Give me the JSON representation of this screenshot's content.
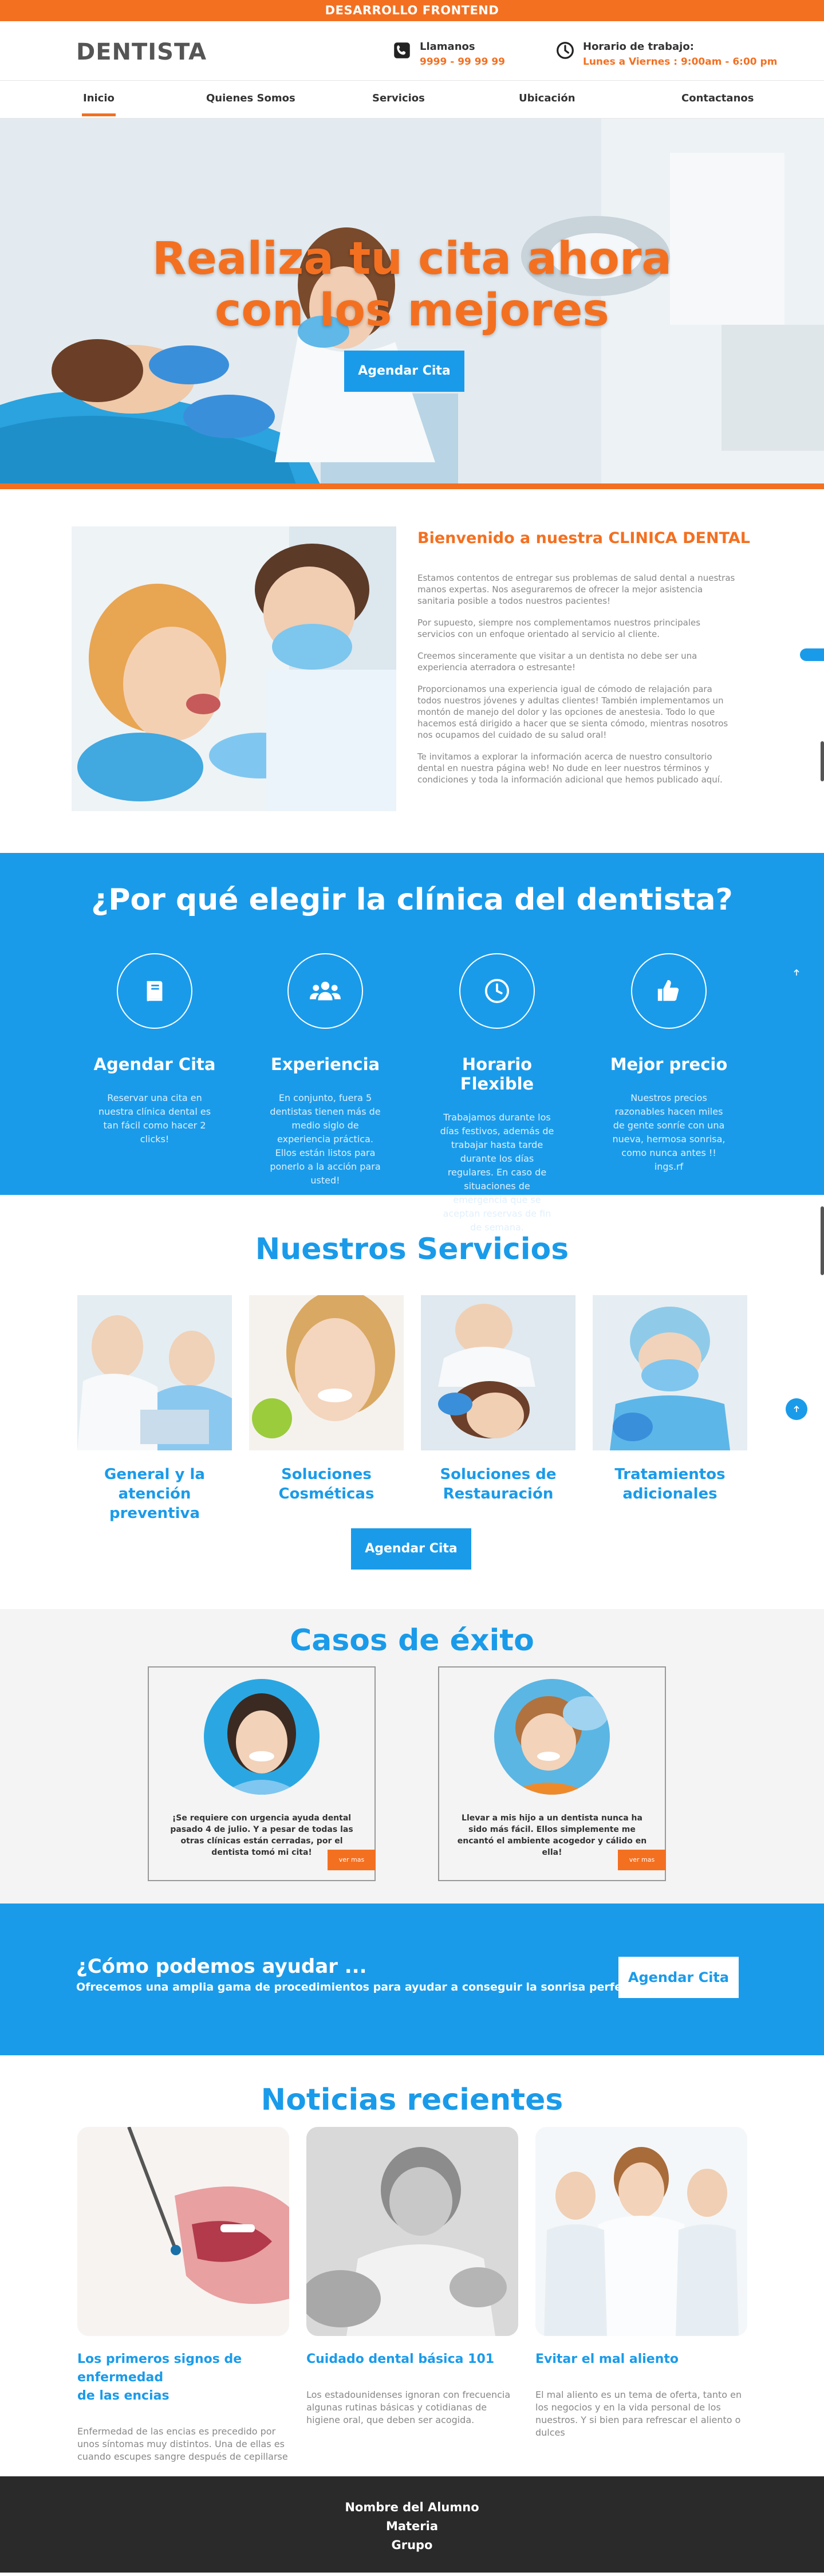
{
  "topbar": {
    "text": "DESARROLLO FRONTEND"
  },
  "header": {
    "logo": "DENTISTA",
    "phone_label": "Llamanos",
    "phone_value": "9999 - 99 99 99",
    "hours_label": "Horario de trabajo:",
    "hours_value": "Lunes a Viernes : 9:00am  - 6:00 pm"
  },
  "nav": {
    "items": [
      "Inicio",
      "Quienes Somos",
      "Servicios",
      "Ubicación",
      "Contactanos"
    ],
    "active": "Inicio"
  },
  "hero": {
    "title_line1": "Realiza tu cita ahora",
    "title_line2": "con los mejores",
    "button": "Agendar Cita"
  },
  "welcome": {
    "title": "Bienvenido a nuestra CLINICA DENTAL",
    "paragraphs": [
      "Estamos contentos de entregar sus problemas de salud dental a nuestras manos expertas. Nos aseguraremos de ofrecer la mejor asistencia sanitaria posible a todos nuestros pacientes!",
      "Por supuesto, siempre nos complementamos nuestros principales servicios con un enfoque orientado al servicio al cliente.",
      "Creemos sinceramente que visitar a un dentista no debe ser una experiencia aterradora o estresante!",
      "Proporcionamos una experiencia igual de cómodo de relajación para todos nuestros jóvenes y adultas clientes! También implementamos un montón de manejo del dolor y las opciones de anestesia. Todo lo que hacemos está dirigido a hacer que se sienta cómodo, mientras nosotros nos ocupamos del cuidado de su salud oral!",
      "Te invitamos a explorar la información acerca de nuestro consultorio dental en nuestra página web! No dude en leer nuestros términos y condiciones y toda la información adicional que hemos publicado aquí."
    ]
  },
  "why": {
    "title": "¿Por qué elegir la clínica del dentista?",
    "features": [
      {
        "icon": "book-icon",
        "title": "Agendar Cita",
        "text": "Reservar una cita en nuestra clínica dental es tan fácil como hacer 2 clicks!"
      },
      {
        "icon": "users-icon",
        "title": "Experiencia",
        "text": "En conjunto, fuera 5 dentistas tienen más de medio siglo de experiencia práctica. Ellos están listos para ponerlo a la acción para usted!"
      },
      {
        "icon": "clock-icon",
        "title": "Horario Flexible",
        "text": "Trabajamos durante los días festivos, además de trabajar hasta tarde durante los días regulares. En caso de situaciones de emergencia que se aceptan reservas de fin de semana."
      },
      {
        "icon": "thumbs-up-icon",
        "title": "Mejor precio",
        "text": "Nuestros precios razonables hacen miles de gente sonríe con una nueva, hermosa sonrisa, como nunca antes !! ings.rf"
      }
    ]
  },
  "services": {
    "title": "Nuestros Servicios",
    "items": [
      {
        "line1": "General y la atención",
        "line2": "preventiva"
      },
      {
        "line1": "Soluciones",
        "line2": "Cosméticas"
      },
      {
        "line1": "Soluciones de",
        "line2": "Restauración"
      },
      {
        "line1": "Tratamientos",
        "line2": "adicionales"
      }
    ],
    "button": "Agendar Cita"
  },
  "cases": {
    "title": "Casos de éxito",
    "items": [
      {
        "text": "¡Se requiere con urgencia ayuda dental pasado 4 de julio. Y a pesar de todas las otras clínicas están cerradas, por el dentista tomó mi cita!",
        "more": "ver mas"
      },
      {
        "text": "Llevar a mis hijo a un dentista nunca ha sido más fácil. Ellos simplemente me encantó el ambiente acogedor y cálido en ella!",
        "more": "ver mas"
      }
    ]
  },
  "help": {
    "title": "¿Cómo podemos ayudar ...",
    "text": "Ofrecemos una amplia gama de procedimientos para ayudar a conseguir la sonrisa perfecta.",
    "button": "Agendar Cita"
  },
  "news": {
    "title": "Noticias recientes",
    "posts": [
      {
        "title_line1": "Los primeros signos de enfermedad",
        "title_line2": "de las encias",
        "text": "Enfermedad de las encias es precedido por unos síntomas muy distintos. Una de ellas es cuando escupes sangre después de cepillarse"
      },
      {
        "title_line1": "Cuidado dental básica 101",
        "title_line2": "",
        "text": "Los estadounidenses ignoran con frecuencia algunas rutinas básicas y cotidianas de higiene oral, que deben ser acogida."
      },
      {
        "title_line1": "Evitar el mal aliento",
        "title_line2": "",
        "text": "El mal aliento es un tema de oferta, tanto en los negocios y en la vida personal de los nuestros. Y si bien para refrescar el aliento o dulces"
      }
    ]
  },
  "footer": {
    "line1": "Nombre del Alumno",
    "line2": "Materia",
    "line3": "Grupo"
  },
  "colors": {
    "orange": "#f37021",
    "blue": "#1a9bea",
    "footer": "#2a2a2a"
  }
}
